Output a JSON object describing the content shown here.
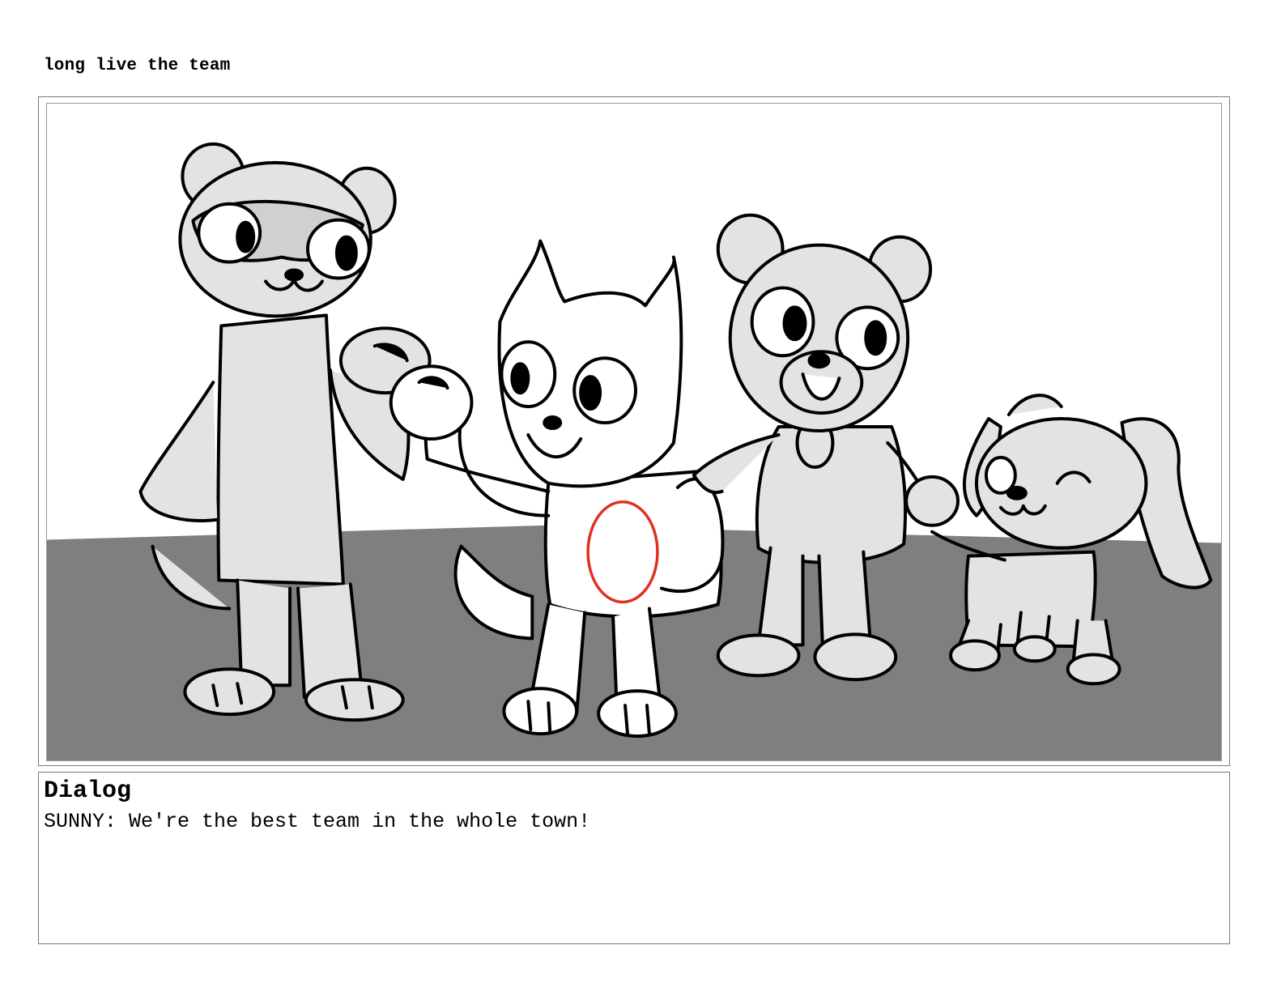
{
  "scene": {
    "title": "long live the team"
  },
  "panel": {
    "characters": [
      "ferret",
      "cat",
      "bear",
      "puppy"
    ],
    "colors": {
      "ground": "#7f7f7f",
      "character_fill": "#e3e3e3",
      "ink": "#000000",
      "annotation": "#e0301e"
    }
  },
  "dialog": {
    "heading": "Dialog",
    "text": "SUNNY: We're the best team in the whole town!"
  }
}
